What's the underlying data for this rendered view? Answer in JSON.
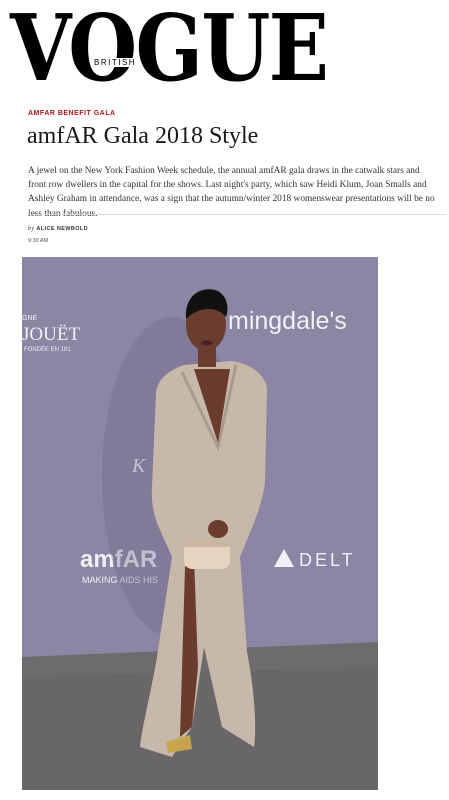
{
  "masthead": {
    "logo": "VOGUE",
    "edition": "BRITISH"
  },
  "article": {
    "kicker": "AMFAR BENEFIT GALA",
    "headline": "amfAR Gala 2018 Style",
    "standfirst": "A jewel on the New York Fashion Week schedule, the annual amfAR gala draws in the catwalk stars and front row dwellers in the capital for the shows. Last night's party, which saw Heidi Klum, Joan Smalls and Ashley Graham in attendance, was a sign that the autumn/winter 2018 womenswear presentations will be no less than fabulous.",
    "byline_prefix": "by",
    "author": "Alice Newbold",
    "time": "9:30 AM"
  },
  "photo": {
    "backdrop_texts": {
      "bloomingdales": "mingdale's",
      "jouet_gne": "GNE",
      "jouet": "JOUËT",
      "fondee": "FONDÉE EN 181",
      "amfar": "amfAR",
      "making_aids": "MAKING AIDS HIS",
      "delta": "DELT",
      "partial_k": "K",
      "partial_si": "SI"
    },
    "colors": {
      "backdrop": "#8f87a6",
      "carpet": "#6e6c6d",
      "gown": "#c9bdb0",
      "skin": "#6b3d2e",
      "clutch": "#e8d5c4"
    }
  }
}
